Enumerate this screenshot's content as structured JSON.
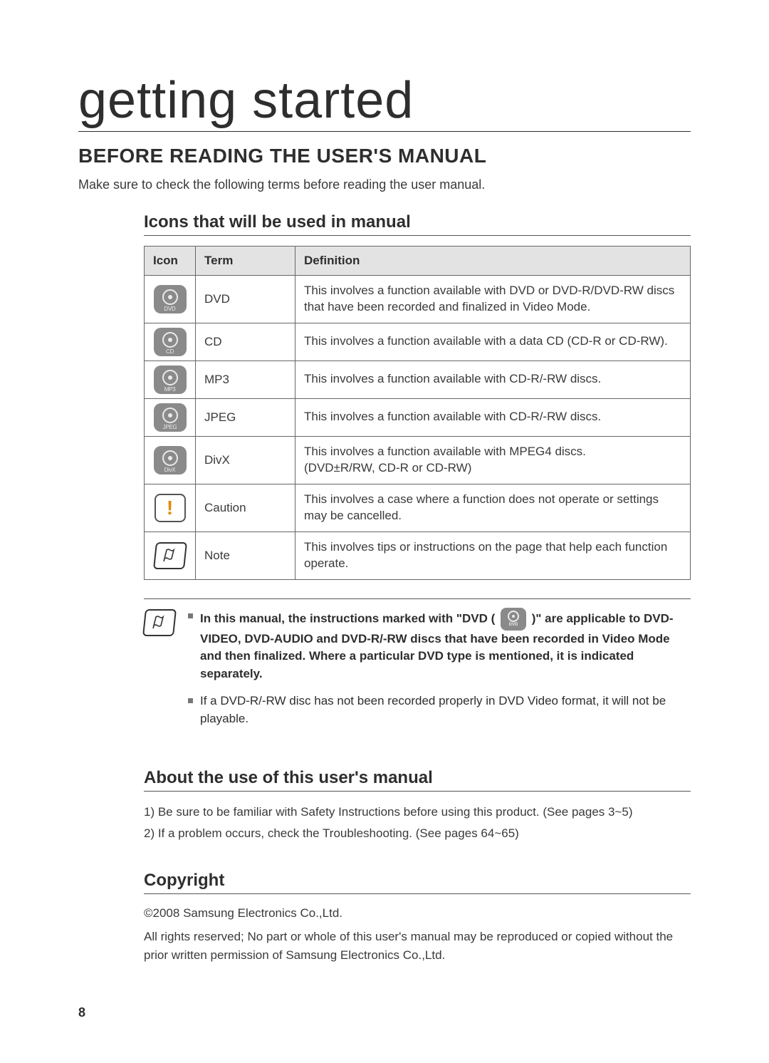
{
  "page_title": "getting started",
  "section_title": "BEFORE READING THE USER'S MANUAL",
  "intro_text": "Make sure to check the following terms before reading the user manual.",
  "icons_section": {
    "title": "Icons that will be used in manual",
    "headers": {
      "icon": "Icon",
      "term": "Term",
      "definition": "Definition"
    },
    "rows": [
      {
        "icon_label": "DVD",
        "term": "DVD",
        "definition": "This involves a function available with DVD or DVD-R/DVD-RW discs that have been recorded and finalized in Video Mode."
      },
      {
        "icon_label": "CD",
        "term": "CD",
        "definition": "This involves a function available with a data CD (CD-R or CD-RW)."
      },
      {
        "icon_label": "MP3",
        "term": "MP3",
        "definition": "This involves a function available with CD-R/-RW discs."
      },
      {
        "icon_label": "JPEG",
        "term": "JPEG",
        "definition": "This involves a function available with CD-R/-RW discs."
      },
      {
        "icon_label": "DivX",
        "term": "DivX",
        "definition": "This involves a function available with MPEG4 discs.\n(DVD±R/RW, CD-R or CD-RW)"
      },
      {
        "icon_label": "!",
        "term": "Caution",
        "definition": "This involves a case where a function does not operate or settings may be cancelled."
      },
      {
        "icon_label": "note",
        "term": "Note",
        "definition": "This involves tips or instructions on the page that help each function operate."
      }
    ]
  },
  "notes": {
    "item1_pre": "In this manual, the instructions marked with \"DVD (",
    "item1_post": ")\" are applicable to DVD-VIDEO, DVD-AUDIO and DVD-R/-RW discs that have been recorded in Video Mode and then finalized. Where a particular DVD type is mentioned, it is indicated separately.",
    "item1_icon_label": "DVD",
    "item2": "If a DVD-R/-RW disc has not been recorded properly in DVD Video format, it will not be playable."
  },
  "about_section": {
    "title": "About the use of this user's manual",
    "items": [
      "1)  Be sure to be familiar with Safety Instructions before using this product. (See pages 3~5)",
      "2)  If a problem occurs, check the Troubleshooting. (See pages 64~65)"
    ]
  },
  "copyright_section": {
    "title": "Copyright",
    "line1": "©2008 Samsung Electronics Co.,Ltd.",
    "line2": "All rights reserved; No part or whole of this user's manual may be reproduced or copied without the prior written permission of Samsung Electronics Co.,Ltd."
  },
  "page_number": "8"
}
